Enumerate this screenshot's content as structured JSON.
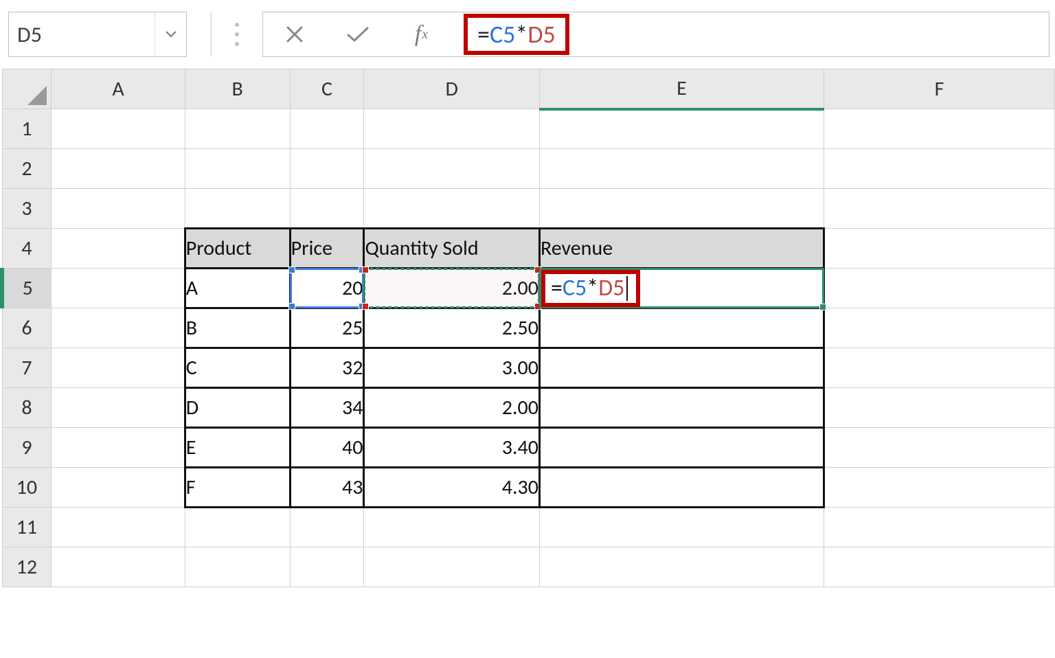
{
  "name_box": "D5",
  "formula_bar": {
    "eq": "=",
    "cref": "C5",
    "star": "*",
    "dref": "D5"
  },
  "columns": [
    "A",
    "B",
    "C",
    "D",
    "E",
    "F"
  ],
  "row_headers": [
    "1",
    "2",
    "3",
    "4",
    "5",
    "6",
    "7",
    "8",
    "9",
    "10",
    "11",
    "12"
  ],
  "headers": {
    "b4": "Product",
    "c4": "Price",
    "d4": "Quantity Sold",
    "e4": "Revenue"
  },
  "rows": [
    {
      "b": "A",
      "c": "20",
      "d": "2.00"
    },
    {
      "b": "B",
      "c": "25",
      "d": "2.50"
    },
    {
      "b": "C",
      "c": "32",
      "d": "3.00"
    },
    {
      "b": "D",
      "c": "34",
      "d": "2.00"
    },
    {
      "b": "E",
      "c": "40",
      "d": "3.40"
    },
    {
      "b": "F",
      "c": "43",
      "d": "4.30"
    }
  ],
  "e5": {
    "eq": "=",
    "cref": "C5",
    "star": "*",
    "dref": "D5"
  },
  "colwidths": {
    "row": 72,
    "A": 195,
    "B": 153,
    "C": 108,
    "D": 256,
    "E": 415,
    "F": 337
  }
}
